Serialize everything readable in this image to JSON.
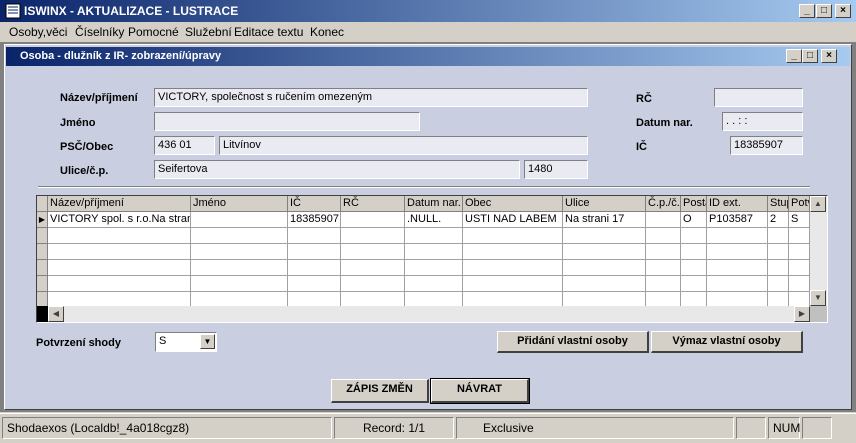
{
  "app": {
    "title": "ISWINX - AKTUALIZACE - LUSTRACE"
  },
  "menu": [
    {
      "label": "Osoby,věci"
    },
    {
      "label": "Číselníky"
    },
    {
      "label": "Pomocné"
    },
    {
      "label": "Služební"
    },
    {
      "label": "Editace textu"
    },
    {
      "label": "Konec"
    }
  ],
  "child": {
    "title": "Osoba - dlužník z IR- zobrazení/úpravy"
  },
  "form": {
    "nazev_label": "Název/příjmení",
    "nazev_value": "VICTORY, společnost s ručením omezeným",
    "jmeno_label": "Jméno",
    "jmeno_value": "",
    "psc_label": "PSČ/Obec",
    "psc_value": "436 01",
    "obec_value": "Litvínov",
    "ulice_label": "Ulice/č.p.",
    "ulice_value": "Seifertova",
    "cp_value": "1480",
    "rc_label": "RČ",
    "rc_value": "",
    "datum_label": "Datum nar.",
    "datum_value": " .  .     :  :",
    "ic_label": "IČ",
    "ic_value": "18385907"
  },
  "grid": {
    "columns": [
      "Název/příjmení",
      "Jméno",
      "IČ",
      "RČ",
      "Datum nar.",
      "Obec",
      "Ulice",
      "Č.p./č.o.",
      "Posta",
      "ID ext.",
      "Stup",
      "Potv"
    ],
    "rows": [
      [
        "VICTORY spol. s r.o.Na strani",
        "",
        "18385907",
        "",
        ".NULL.",
        "USTI NAD LABEM",
        "Na strani 17",
        "",
        "O",
        "P103587",
        "2",
        "S"
      ]
    ]
  },
  "shoda": {
    "label": "Potvrzení shody",
    "value": "S"
  },
  "buttons": {
    "pridani": "Přidání vlastní osoby",
    "vymaz": "Výmaz vlastní osoby",
    "zapis": "ZÁPIS ZMĚN",
    "navrat": "NÁVRAT"
  },
  "status": {
    "db": "Shodaexos (Localdb!_4a018cgz8)",
    "record": "Record: 1/1",
    "mode": "Exclusive",
    "num": "NUM"
  }
}
